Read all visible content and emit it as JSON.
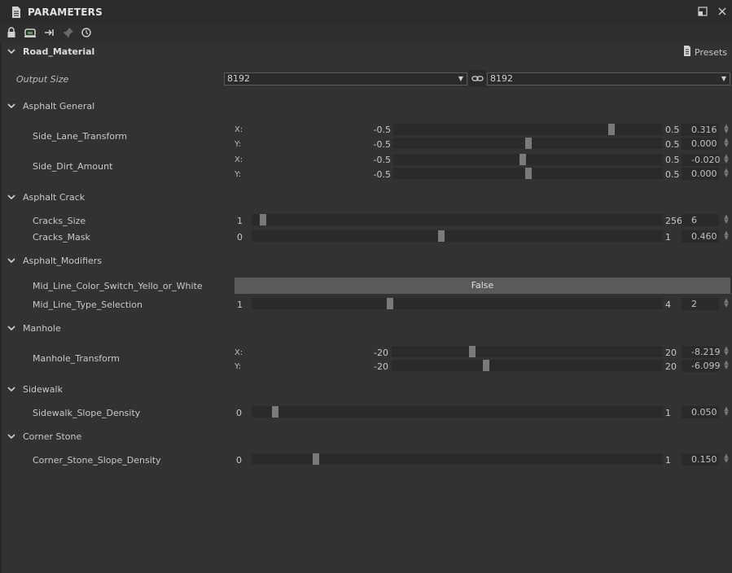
{
  "panel": {
    "title": "PARAMETERS"
  },
  "material": {
    "name": "Road_Material",
    "presets_label": "Presets"
  },
  "output_size": {
    "label": "Output Size",
    "width": "8192",
    "height": "8192"
  },
  "sections": {
    "asphalt_general": "Asphalt General",
    "asphalt_crack": "Asphalt Crack",
    "asphalt_modifiers": "Asphalt_Modifiers",
    "manhole": "Manhole",
    "sidewalk": "Sidewalk",
    "corner_stone": "Corner Stone"
  },
  "params": {
    "side_lane_transform": {
      "label": "Side_Lane_Transform",
      "x": {
        "axis": "X:",
        "min": "-0.5",
        "max": "0.5",
        "value": "0.316"
      },
      "y": {
        "axis": "Y:",
        "min": "-0.5",
        "max": "0.5",
        "value": "0.000"
      }
    },
    "side_dirt_amount": {
      "label": "Side_Dirt_Amount",
      "x": {
        "axis": "X:",
        "min": "-0.5",
        "max": "0.5",
        "value": "-0.020"
      },
      "y": {
        "axis": "Y:",
        "min": "-0.5",
        "max": "0.5",
        "value": "0.000"
      }
    },
    "cracks_size": {
      "label": "Cracks_Size",
      "min": "1",
      "max": "256",
      "value": "6"
    },
    "cracks_mask": {
      "label": "Cracks_Mask",
      "min": "0",
      "max": "1",
      "value": "0.460"
    },
    "mid_line_color": {
      "label": "Mid_Line_Color_Switch_Yello_or_White",
      "value": "False"
    },
    "mid_line_type": {
      "label": "Mid_Line_Type_Selection",
      "min": "1",
      "max": "4",
      "value": "2"
    },
    "manhole_transform": {
      "label": "Manhole_Transform",
      "x": {
        "axis": "X:",
        "min": "-20",
        "max": "20",
        "value": "-8.219"
      },
      "y": {
        "axis": "Y:",
        "min": "-20",
        "max": "20",
        "value": "-6.099"
      }
    },
    "sidewalk_slope_density": {
      "label": "Sidewalk_Slope_Density",
      "min": "0",
      "max": "1",
      "value": "0.050"
    },
    "corner_stone_slope_density": {
      "label": "Corner_Stone_Slope_Density",
      "min": "0",
      "max": "1",
      "value": "0.150"
    }
  }
}
